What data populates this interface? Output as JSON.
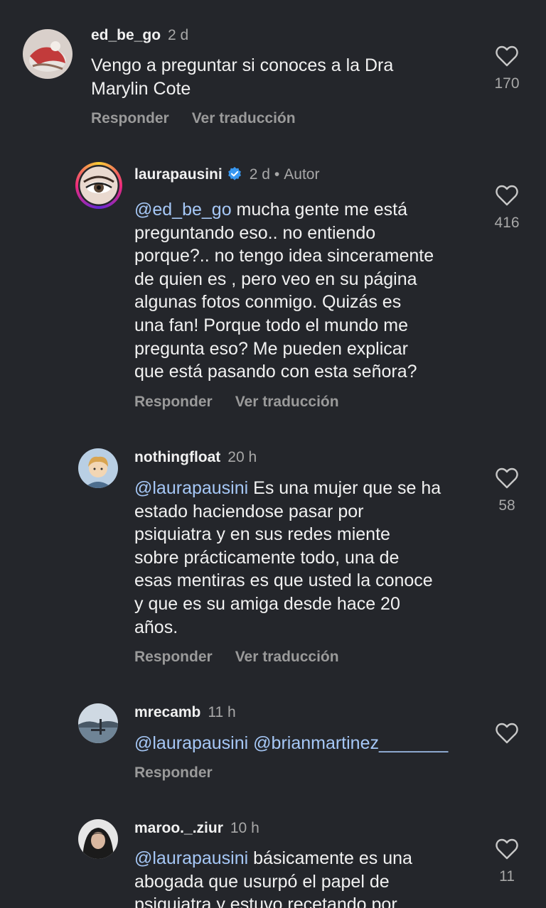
{
  "comments": [
    {
      "username": "ed_be_go",
      "time": "2 d",
      "author_tag": "",
      "mention": "",
      "text_lines": [
        "Vengo a preguntar si conoces a la Dra",
        "Marylin Cote"
      ],
      "likes": "170",
      "actions": {
        "reply": "Responder",
        "translate": "Ver traducción"
      }
    },
    {
      "username": "laurapausini",
      "time": "2 d",
      "author_tag": "Autor",
      "verified": true,
      "mention": "@ed_be_go",
      "text_first": " mucha gente me está",
      "text_lines": [
        "preguntando eso.. no entiendo",
        "porque?.. no tengo idea sinceramente",
        "de quien es , pero veo en su página",
        "algunas fotos conmigo. Quizás es",
        "una fan! Porque todo el mundo me",
        "pregunta eso? Me pueden explicar",
        "que está pasando con esta señora?"
      ],
      "likes": "416",
      "actions": {
        "reply": "Responder",
        "translate": "Ver traducción"
      }
    },
    {
      "username": "nothingfloat",
      "time": "20 h",
      "mention": "@laurapausini",
      "text_first": " Es una mujer que se ha",
      "text_lines": [
        "estado haciendose pasar por",
        "psiquiatra y en sus redes miente",
        "sobre prácticamente todo, una de",
        "esas mentiras es que usted la conoce",
        "y que es su amiga desde hace 20",
        "años."
      ],
      "likes": "58",
      "actions": {
        "reply": "Responder",
        "translate": "Ver traducción"
      }
    },
    {
      "username": "mrecamb",
      "time": "11 h",
      "mention": "@laurapausini",
      "mention2": "@brianmartinez_______",
      "likes": "",
      "actions": {
        "reply": "Responder"
      }
    },
    {
      "username": "maroo._.ziur",
      "time": "10 h",
      "mention": "@laurapausini",
      "text_first": " básicamente es una",
      "text_lines": [
        "abogada que usurpó el papel de",
        "psiquiatra y estuvo recetando por"
      ],
      "likes": "11"
    }
  ],
  "icons": {
    "like": "heart-outline-icon",
    "verified": "verified-badge-icon"
  },
  "colors": {
    "background": "#24262b",
    "mention": "#a6c8f7",
    "muted": "#a8a8a8",
    "verified": "#3897f0"
  }
}
